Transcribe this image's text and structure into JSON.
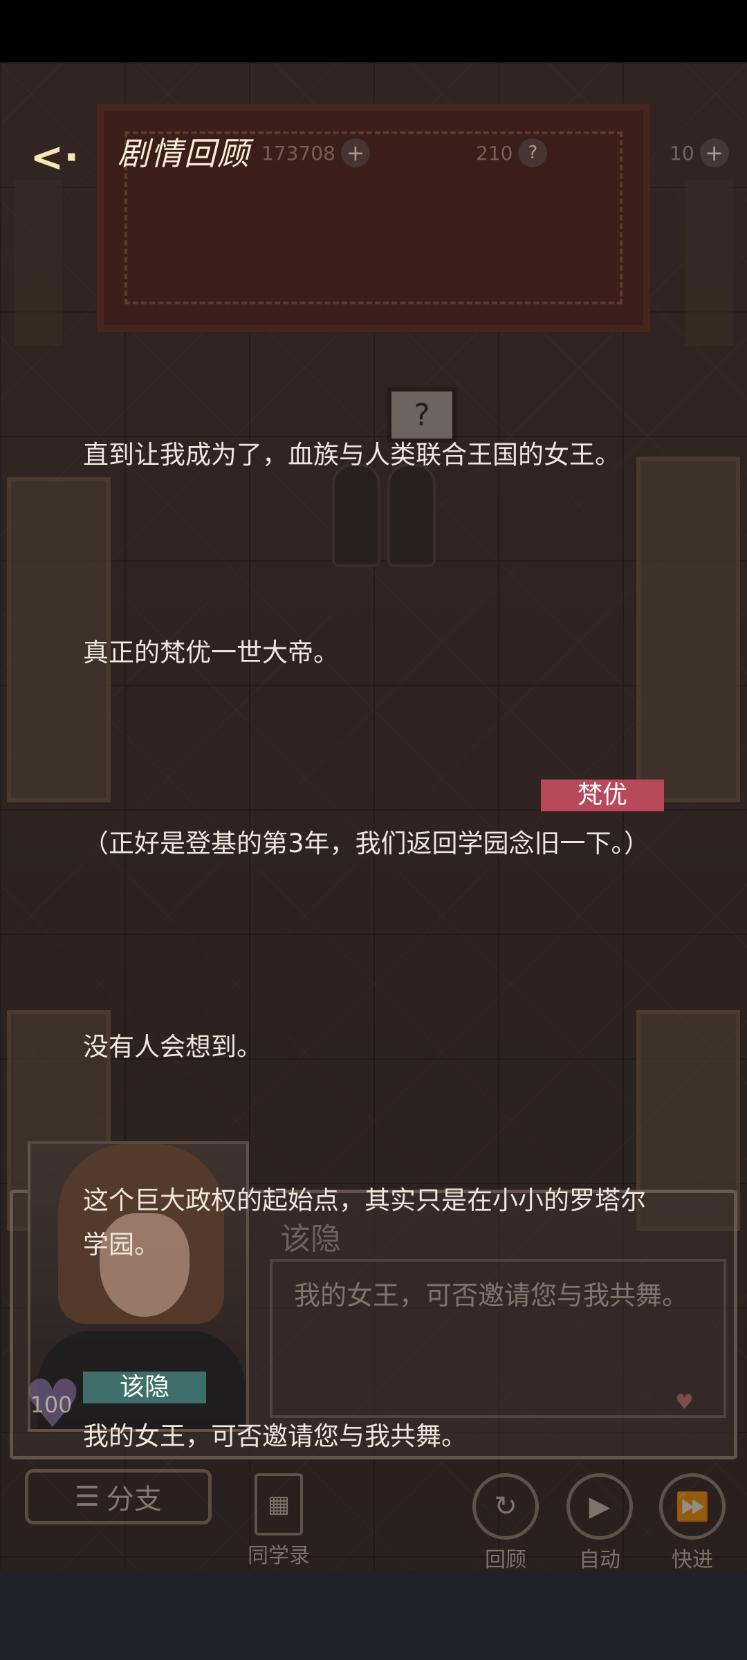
{
  "header": {
    "title": "剧情回顾",
    "resources": [
      {
        "value": "173708"
      },
      {
        "value": "210"
      },
      {
        "value": "10"
      }
    ]
  },
  "scene": {
    "bubble_symbol": "?"
  },
  "log": [
    {
      "speaker": "",
      "text": "直到让我成为了，血族与人类联合王国的女王。"
    },
    {
      "speaker": "",
      "text": "真正的梵优一世大帝。"
    },
    {
      "speaker": "梵优",
      "text": "（正好是登基的第3年，我们返回学园念旧一下。）"
    },
    {
      "speaker": "",
      "text": "没有人会想到。"
    },
    {
      "speaker": "",
      "text": "这个巨大政权的起始点，其实只是在小小的罗塔尔学园。"
    },
    {
      "speaker": "该隐",
      "text": "我的女王，可否邀请您与我共舞。"
    }
  ],
  "dialog_box": {
    "name": "该隐",
    "text": "我的女王，可否邀请您与我共舞。",
    "affection": "100"
  },
  "bottom_bar": {
    "branch_label": "分支",
    "classmates_label": "同学录",
    "review_label": "回顾",
    "auto_label": "自动",
    "fast_label": "快进"
  },
  "colors": {
    "speaker_female": "#b8495a",
    "speaker_male": "#3f6f6b"
  }
}
